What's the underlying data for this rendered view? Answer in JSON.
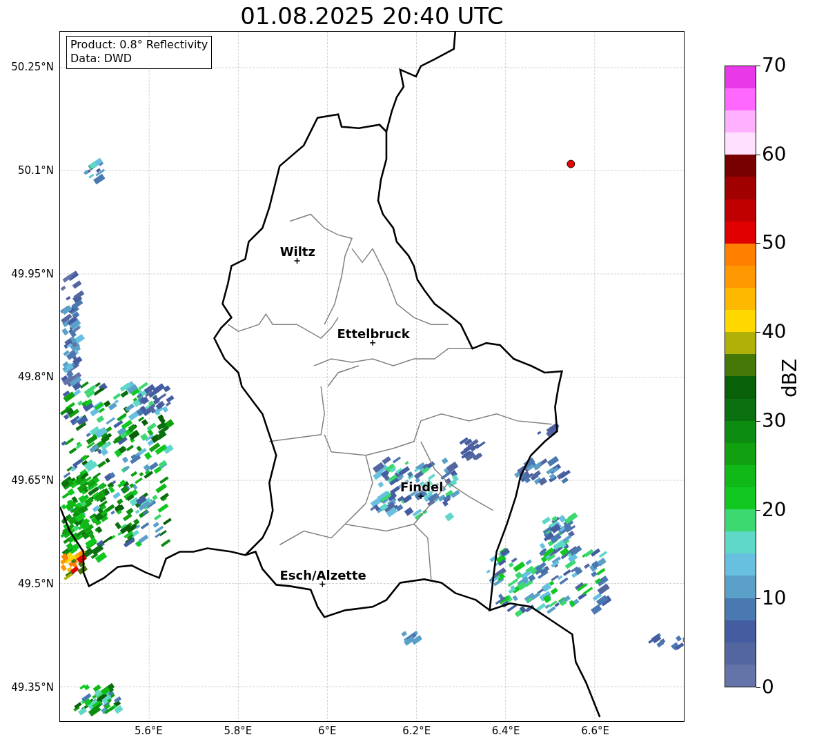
{
  "title": "01.08.2025 20:40 UTC",
  "info_box": [
    "Product: 0.8° Reflectivity",
    "Data: DWD"
  ],
  "cities": [
    {
      "name": "Wiltz"
    },
    {
      "name": "Ettelbruck"
    },
    {
      "name": "Findel"
    },
    {
      "name": "Esch/Alzette"
    }
  ],
  "x_ticks": [
    "5.6°E",
    "5.8°E",
    "6°E",
    "6.2°E",
    "6.4°E",
    "6.6°E"
  ],
  "y_ticks": [
    "50.25°N",
    "50.1°N",
    "49.95°N",
    "49.8°N",
    "49.65°N",
    "49.5°N",
    "49.35°N"
  ],
  "colorbar": {
    "label": "dBZ",
    "ticks": [
      "70",
      "60",
      "50",
      "40",
      "30",
      "20",
      "10",
      "0"
    ],
    "bands": [
      {
        "color": "#6474a8"
      },
      {
        "color": "#5466a0"
      },
      {
        "color": "#445ca0"
      },
      {
        "color": "#4a78b0"
      },
      {
        "color": "#5aa0c8"
      },
      {
        "color": "#68c0e0"
      },
      {
        "color": "#60d8c8"
      },
      {
        "color": "#3cd870"
      },
      {
        "color": "#10c820"
      },
      {
        "color": "#10b818"
      },
      {
        "color": "#10a010"
      },
      {
        "color": "#0c8c10"
      },
      {
        "color": "#0a7010"
      },
      {
        "color": "#086008"
      },
      {
        "color": "#467808"
      },
      {
        "color": "#b0b008"
      },
      {
        "color": "#ffd800"
      },
      {
        "color": "#ffb800"
      },
      {
        "color": "#ff9800"
      },
      {
        "color": "#ff8000"
      },
      {
        "color": "#e00000"
      },
      {
        "color": "#c00000"
      },
      {
        "color": "#a00000"
      },
      {
        "color": "#780000"
      },
      {
        "color": "#ffe0ff"
      },
      {
        "color": "#ffb0ff"
      },
      {
        "color": "#ff68ff"
      },
      {
        "color": "#e838e8"
      }
    ]
  }
}
